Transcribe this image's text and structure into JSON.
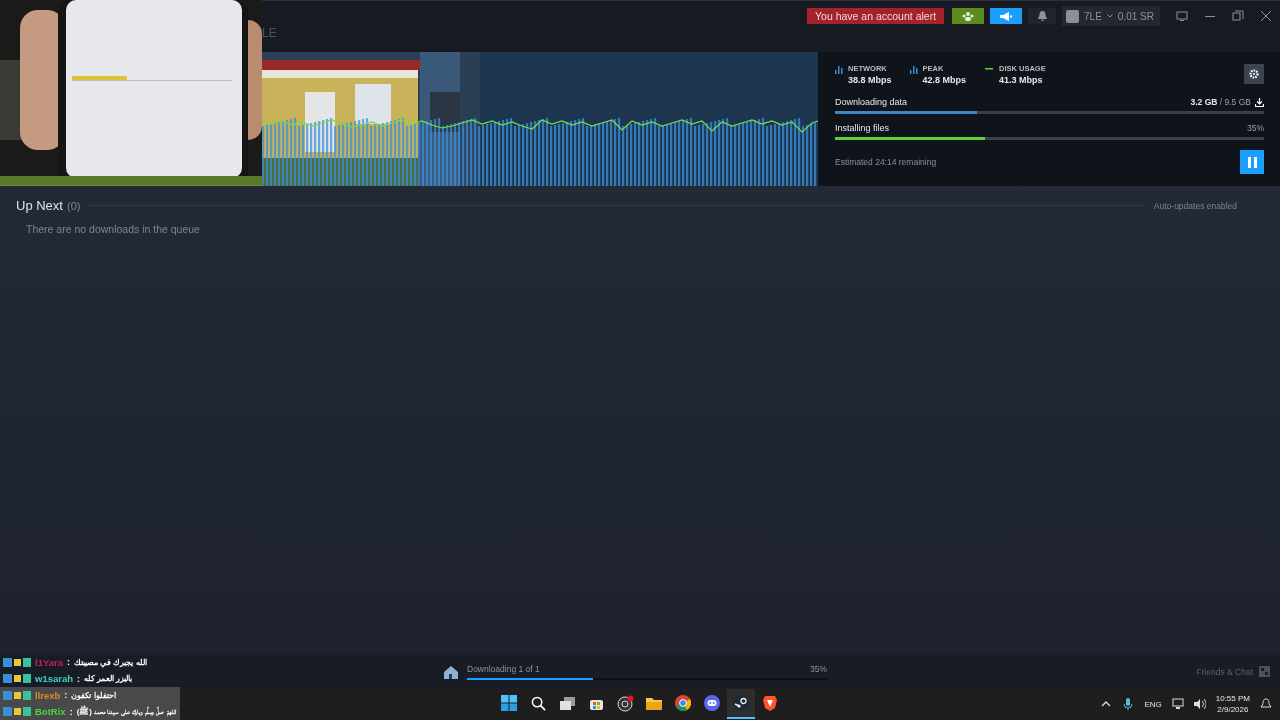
{
  "header": {
    "title": "LE",
    "alert": "You have an account alert",
    "account": {
      "name": "7LE",
      "wallet": "0.01 SR"
    }
  },
  "stats": [
    {
      "kind": "bars",
      "label": "NETWORK",
      "value": "38.8 Mbps"
    },
    {
      "kind": "bars",
      "label": "PEAK",
      "value": "42.8 Mbps"
    },
    {
      "kind": "line",
      "label": "DISK USAGE",
      "value": "41.3 Mbps"
    }
  ],
  "progress": [
    {
      "kind": "download",
      "label": "Downloading data",
      "done": "3.2 GB",
      "total": "/ 9.5 GB",
      "level": 0.33
    },
    {
      "kind": "install",
      "label": "Installing files",
      "reading": "35%",
      "level": 0.35
    }
  ],
  "estimate": "Estimated 24:14 remaining",
  "queue": {
    "title": "Up Next",
    "count": "(0)",
    "empty_text": "There are no downloads in the queue",
    "auto_updates": "Auto-updates enabled"
  },
  "footer": {
    "status": "Downloading 1 of 1",
    "reading": "35%",
    "level": 0.35,
    "friends": "Friends & Chat"
  },
  "chat": [
    {
      "name": "l1Yara",
      "color": "#c0234f",
      "separator": ":",
      "message": "الله يجبرك في مصيبتك"
    },
    {
      "name": "w1sarah",
      "color": "#3fd0c0",
      "separator": ":",
      "message": "بالبزر العمر كله"
    },
    {
      "name": "llrexb",
      "color": "#d98a2b",
      "separator": ":",
      "message": "احتفلوا تكفون"
    },
    {
      "name": "BotRix",
      "color": "#4cd63a",
      "separator": ":",
      "message": "اللهمّ صلِّ وسلِّم وبارك على سيدنا محمد (ﷺ)"
    }
  ],
  "taskbar": {
    "apps": [
      {
        "kind": "start",
        "selected": false
      },
      {
        "kind": "search",
        "selected": false
      },
      {
        "kind": "taskview",
        "selected": false
      },
      {
        "kind": "store",
        "selected": false
      },
      {
        "kind": "recorder",
        "selected": false
      },
      {
        "kind": "folder",
        "selected": false
      },
      {
        "kind": "browser",
        "selected": false
      },
      {
        "kind": "chat",
        "selected": false
      },
      {
        "kind": "steam",
        "selected": true
      },
      {
        "kind": "lion",
        "selected": false
      }
    ],
    "language": "ENG",
    "time": "10:55 PM",
    "date": "2/9/2026"
  }
}
